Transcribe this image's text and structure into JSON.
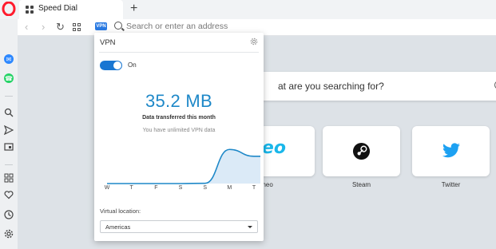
{
  "tabs": [
    {
      "title": "Speed Dial",
      "icon": "speed-dial-icon"
    }
  ],
  "toolbar": {
    "address_placeholder": "Search or enter an address",
    "vpn_badge": "VPN"
  },
  "sidebar": {
    "items": [
      "messenger-icon",
      "whatsapp-icon",
      "search-icon",
      "send-icon",
      "snapshot-icon",
      "speed-dial-icon",
      "heart-icon",
      "history-icon",
      "settings-icon"
    ]
  },
  "page": {
    "search_text": "at are you searching for?",
    "tiles": [
      {
        "label": "Vimeo",
        "logo_text": "meo",
        "icon": "vimeo-icon"
      },
      {
        "label": "Steam",
        "icon": "steam-icon"
      },
      {
        "label": "Twitter",
        "icon": "twitter-icon"
      }
    ]
  },
  "vpn": {
    "title": "VPN",
    "toggle_label": "On",
    "enabled": true,
    "amount": "35.2 MB",
    "amount_caption": "Data transferred this month",
    "unlimited_text": "You have unlimited VPN data",
    "location_label": "Virtual location:",
    "location_value": "Americas",
    "accent": "#1e88c8"
  },
  "chart_data": {
    "type": "area",
    "categories": [
      "W",
      "T",
      "F",
      "S",
      "S",
      "M",
      "T"
    ],
    "values": [
      0,
      0,
      0,
      0,
      0.2,
      30,
      24
    ],
    "ylim": [
      0,
      40
    ],
    "grid": false
  }
}
